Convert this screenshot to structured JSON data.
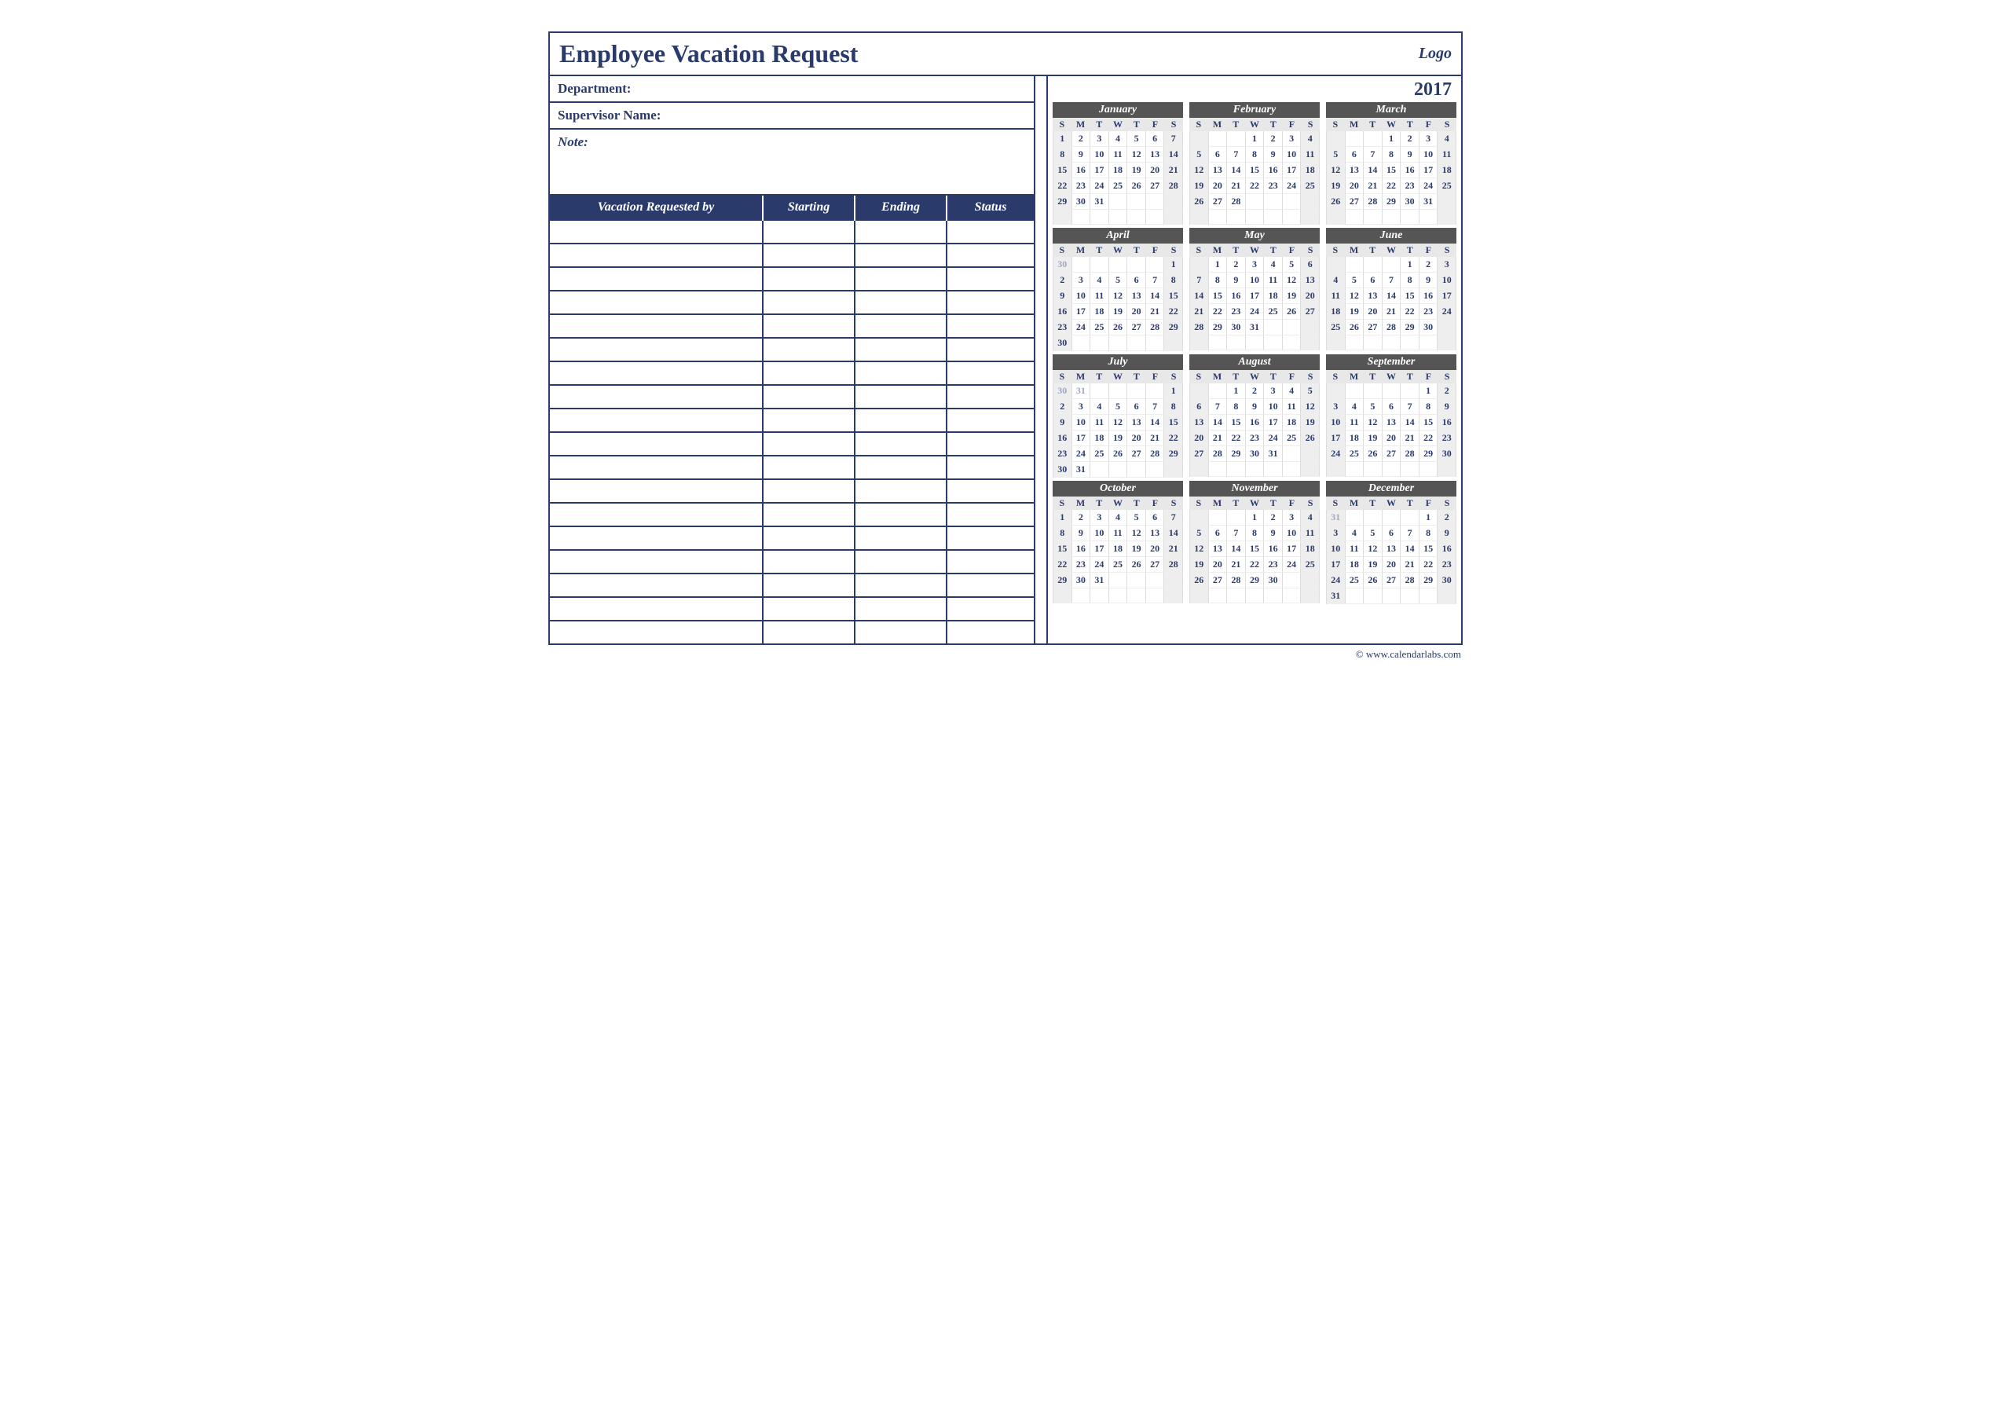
{
  "title": "Employee Vacation Request",
  "logo": "Logo",
  "fields": {
    "department": "Department:",
    "supervisor": "Supervisor Name:",
    "note": "Note:"
  },
  "table": {
    "headers": [
      "Vacation Requested by",
      "Starting",
      "Ending",
      "Status"
    ],
    "rows": 18
  },
  "year": "2017",
  "dow": [
    "S",
    "M",
    "T",
    "W",
    "T",
    "F",
    "S"
  ],
  "months": [
    {
      "name": "January",
      "offset": 0,
      "count": 31,
      "prev": []
    },
    {
      "name": "February",
      "offset": 3,
      "count": 28,
      "prev": []
    },
    {
      "name": "March",
      "offset": 3,
      "count": 31,
      "prev": []
    },
    {
      "name": "April",
      "offset": 6,
      "count": 30,
      "prev": [
        30
      ],
      "prevOffset": 0
    },
    {
      "name": "May",
      "offset": 1,
      "count": 31,
      "prev": []
    },
    {
      "name": "June",
      "offset": 4,
      "count": 30,
      "prev": []
    },
    {
      "name": "July",
      "offset": 6,
      "count": 31,
      "prev": [
        30,
        31
      ],
      "prevOffset": 0
    },
    {
      "name": "August",
      "offset": 2,
      "count": 31,
      "prev": []
    },
    {
      "name": "September",
      "offset": 5,
      "count": 30,
      "prev": []
    },
    {
      "name": "October",
      "offset": 0,
      "count": 31,
      "prev": []
    },
    {
      "name": "November",
      "offset": 3,
      "count": 30,
      "prev": []
    },
    {
      "name": "December",
      "offset": 5,
      "count": 31,
      "prev": [
        31
      ],
      "prevOffset": 0
    }
  ],
  "footer": "© www.calendarlabs.com"
}
